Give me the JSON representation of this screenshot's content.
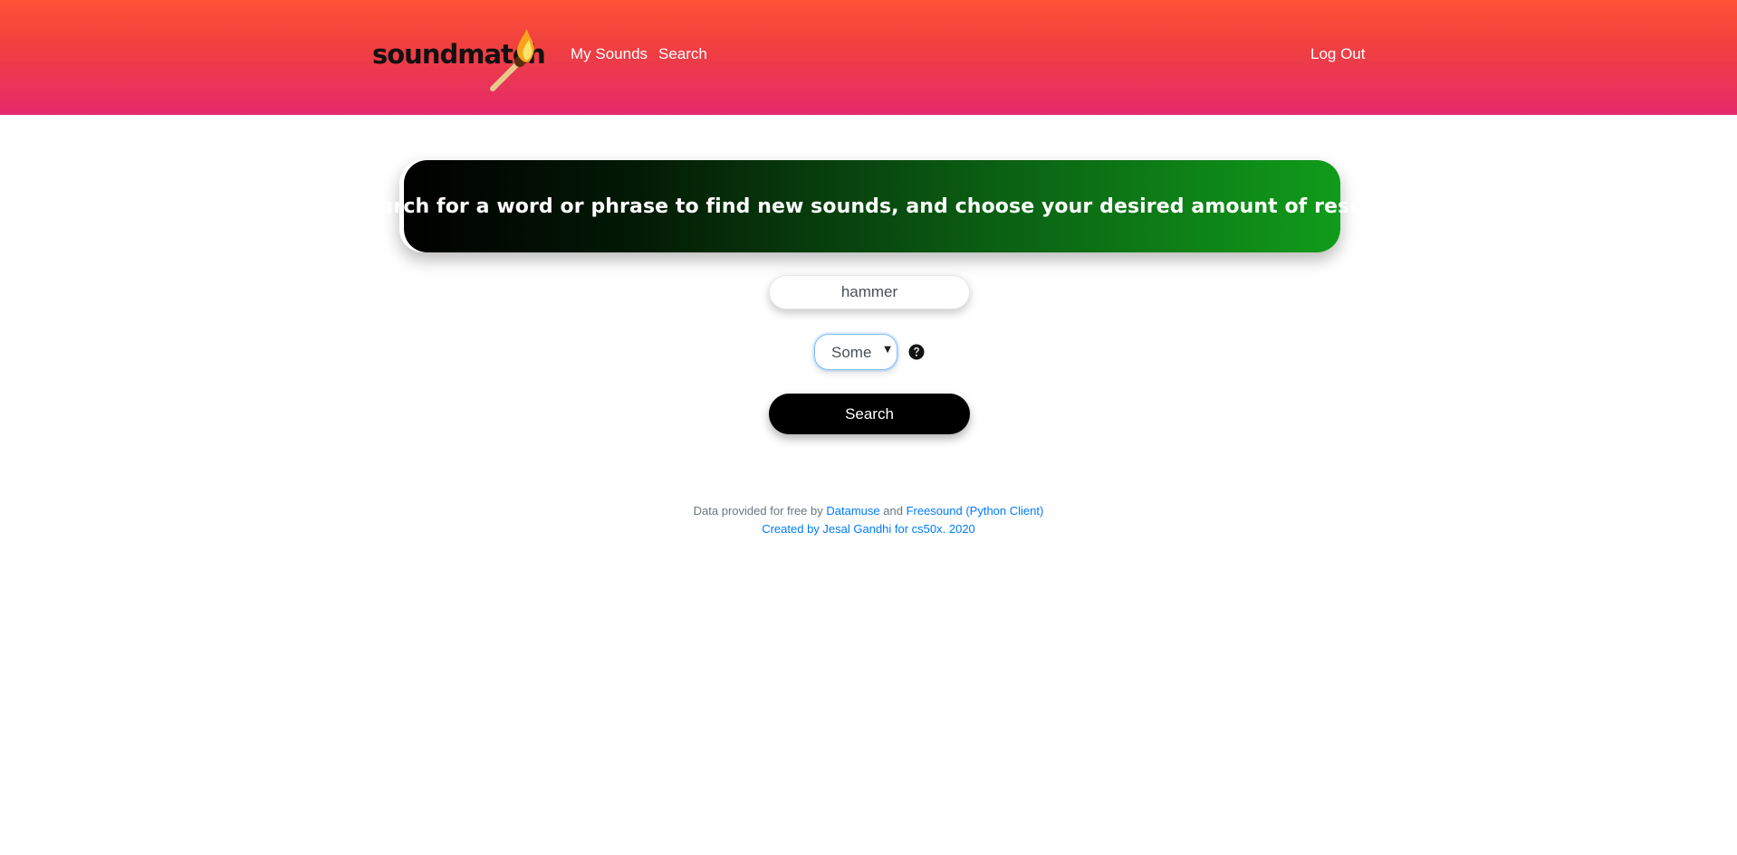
{
  "header": {
    "brand": "soundmatch",
    "nav": {
      "my_sounds": "My Sounds",
      "search": "Search",
      "log_out": "Log Out"
    },
    "colors": {
      "gradient_top": "#ff5236",
      "gradient_bottom": "#e42a6c"
    }
  },
  "main": {
    "banner_text": "Search for a word or phrase to find new sounds, and choose your desired amount of results",
    "search_input": {
      "value": "hammer"
    },
    "results_select": {
      "selected": "Some"
    },
    "help_icon": "question-circle-icon",
    "search_button": "Search",
    "colors": {
      "banner_start": "#000000",
      "banner_end": "#109c1a"
    }
  },
  "footer": {
    "data_prefix": "Data provided for free by",
    "datamuse": "Datamuse",
    "and": "and",
    "freesound": "Freesound (Python Client)",
    "credit": "Created by Jesal Gandhi for cs50x. 2020",
    "link_color": "#007bff"
  }
}
